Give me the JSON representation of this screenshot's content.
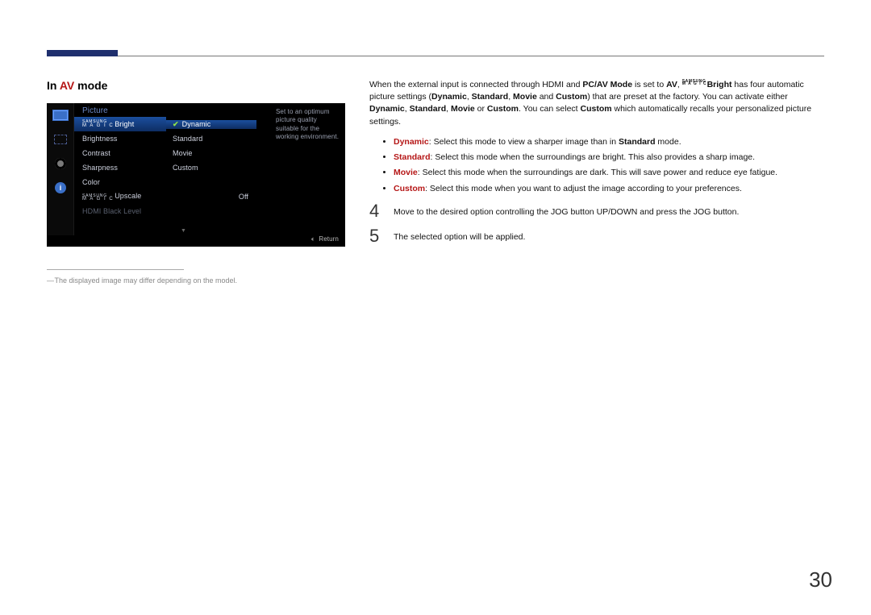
{
  "heading": {
    "prefix": "In ",
    "accent": "AV",
    "suffix": " mode"
  },
  "osd": {
    "title": "Picture",
    "magic_bright_suffix": "Bright",
    "menu": [
      "Brightness",
      "Contrast",
      "Sharpness",
      "Color"
    ],
    "upscale_suffix": "Upscale",
    "upscale_value": "Off",
    "disabled_item": "HDMI Black Level",
    "options": [
      "Dynamic",
      "Standard",
      "Movie",
      "Custom"
    ],
    "desc": "Set to an optimum picture quality suitable for the working environment.",
    "return_label": "Return"
  },
  "footnote": "The displayed image may differ depending on the model.",
  "intro": {
    "p1a": "When the external input is connected through HDMI and ",
    "pcav": "PC/AV Mode",
    "p1b": " is set to ",
    "av": "AV",
    "comma": ", ",
    "bright": "Bright",
    "p1c": " has four automatic picture settings (",
    "d": "Dynamic",
    "s": "Standard",
    "m": "Movie",
    "c": "Custom",
    "p1d": " and ",
    "p1e": ") that are preset at the factory. You can activate either ",
    "p1f": " or ",
    "p1g": ". You can select ",
    "p1h": " which automatically recalls your personalized picture settings.",
    "sep": ", "
  },
  "bullets": {
    "dynamic": {
      "label": "Dynamic",
      "text": ": Select this mode to view a sharper image than in ",
      "bold": "Standard",
      "tail": " mode."
    },
    "standard": {
      "label": "Standard",
      "text": ": Select this mode when the surroundings are bright. This also provides a sharp image."
    },
    "movie": {
      "label": "Movie",
      "text": ": Select this mode when the surroundings are dark. This will save power and reduce eye fatigue."
    },
    "custom": {
      "label": "Custom",
      "text": ": Select this mode when you want to adjust the image according to your preferences."
    }
  },
  "steps": {
    "n4": "4",
    "t4": "Move to the desired option controlling the JOG button UP/DOWN and press the JOG button.",
    "n5": "5",
    "t5": "The selected option will be applied."
  },
  "page_number": "30"
}
